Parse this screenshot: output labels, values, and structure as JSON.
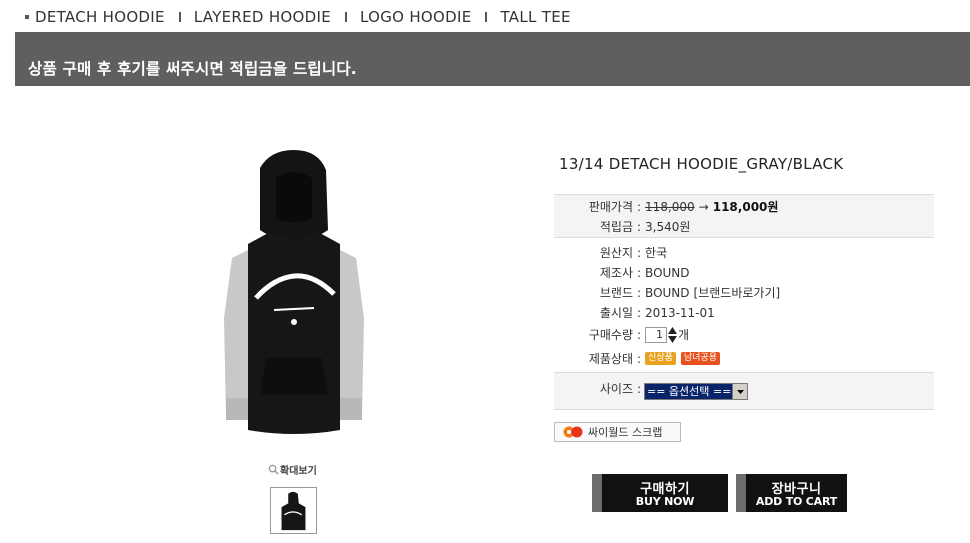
{
  "nav": {
    "items": [
      "DETACH HOODIE",
      "LAYERED HOODIE",
      "LOGO HOODIE",
      "TALL TEE"
    ]
  },
  "banner": {
    "message": "상품 구매 후 후기를 써주시면 적립금을 드립니다."
  },
  "gallery": {
    "zoom_label": "확대보기"
  },
  "product": {
    "title": "13/14 DETACH HOODIE_GRAY/BLACK",
    "price_label": "판매가격",
    "price_old": "118,000",
    "price_arrow": "→",
    "price_new": "118,000원",
    "points_label": "적립금",
    "points_value": "3,540원",
    "origin_label": "원산지",
    "origin_value": "한국",
    "maker_label": "제조사",
    "maker_value": "BOUND",
    "brand_label": "브랜드",
    "brand_value": "BOUND",
    "brand_link": "[브랜드바로가기]",
    "release_label": "출시일",
    "release_value": "2013-11-01",
    "qty_label": "구매수량",
    "qty_value": "1",
    "qty_unit": "개",
    "status_label": "제품상태",
    "badges": [
      "신상품",
      "남녀공용"
    ],
    "size_label": "사이즈",
    "size_selected": "== 옵션선택 =="
  },
  "scrap": {
    "label": "싸이월드 스크랩"
  },
  "buttons": {
    "buy_kr": "구매하기",
    "buy_en": "BUY NOW",
    "cart_kr": "장바구니",
    "cart_en": "ADD TO CART"
  },
  "colors": {
    "banner_bg": "#5f5f5f",
    "badge_new": "#e8a21e",
    "badge_unisex": "#e8501e",
    "button_bg": "#111111"
  }
}
